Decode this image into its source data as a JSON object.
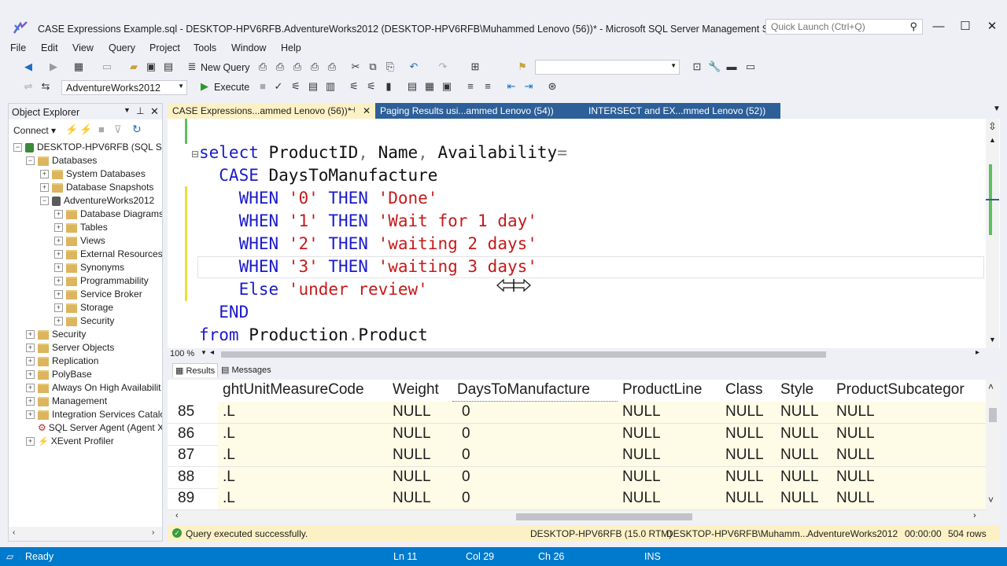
{
  "window": {
    "title": "CASE Expressions Example.sql - DESKTOP-HPV6RFB.AdventureWorks2012 (DESKTOP-HPV6RFB\\Muhammed Lenovo (56))* - Microsoft SQL Server Management Studio (Adm...",
    "quick_launch_placeholder": "Quick Launch (Ctrl+Q)",
    "minimize": "—",
    "maximize": "☐",
    "close": "✕"
  },
  "menu": [
    "File",
    "Edit",
    "View",
    "Query",
    "Project",
    "Tools",
    "Window",
    "Help"
  ],
  "toolbar": {
    "new_query": "New Query",
    "database": "AdventureWorks2012",
    "execute": "Execute"
  },
  "object_explorer": {
    "title": "Object Explorer",
    "connect": "Connect",
    "tree": [
      {
        "label": "DESKTOP-HPV6RFB (SQL Serv",
        "level": 0,
        "icon": "server",
        "exp": "−"
      },
      {
        "label": "Databases",
        "level": 1,
        "icon": "folder",
        "exp": "−"
      },
      {
        "label": "System Databases",
        "level": 2,
        "icon": "folder",
        "exp": "+"
      },
      {
        "label": "Database Snapshots",
        "level": 2,
        "icon": "folder",
        "exp": "+"
      },
      {
        "label": "AdventureWorks2012",
        "level": 2,
        "icon": "db",
        "exp": "−"
      },
      {
        "label": "Database Diagrams",
        "level": 3,
        "icon": "folder",
        "exp": "+"
      },
      {
        "label": "Tables",
        "level": 3,
        "icon": "folder",
        "exp": "+"
      },
      {
        "label": "Views",
        "level": 3,
        "icon": "folder",
        "exp": "+"
      },
      {
        "label": "External Resources",
        "level": 3,
        "icon": "folder",
        "exp": "+"
      },
      {
        "label": "Synonyms",
        "level": 3,
        "icon": "folder",
        "exp": "+"
      },
      {
        "label": "Programmability",
        "level": 3,
        "icon": "folder",
        "exp": "+"
      },
      {
        "label": "Service Broker",
        "level": 3,
        "icon": "folder",
        "exp": "+"
      },
      {
        "label": "Storage",
        "level": 3,
        "icon": "folder",
        "exp": "+"
      },
      {
        "label": "Security",
        "level": 3,
        "icon": "folder",
        "exp": "+"
      },
      {
        "label": "Security",
        "level": 1,
        "icon": "folder",
        "exp": "+"
      },
      {
        "label": "Server Objects",
        "level": 1,
        "icon": "folder",
        "exp": "+"
      },
      {
        "label": "Replication",
        "level": 1,
        "icon": "folder",
        "exp": "+"
      },
      {
        "label": "PolyBase",
        "level": 1,
        "icon": "folder",
        "exp": "+"
      },
      {
        "label": "Always On High Availabilit",
        "level": 1,
        "icon": "folder",
        "exp": "+"
      },
      {
        "label": "Management",
        "level": 1,
        "icon": "folder",
        "exp": "+"
      },
      {
        "label": "Integration Services Catalo",
        "level": 1,
        "icon": "folder",
        "exp": "+"
      },
      {
        "label": "SQL Server Agent (Agent X",
        "level": 1,
        "icon": "agent",
        "exp": ""
      },
      {
        "label": "XEvent Profiler",
        "level": 1,
        "icon": "xevent",
        "exp": "+"
      }
    ]
  },
  "tabs": [
    {
      "label": "CASE Expressions...ammed Lenovo (56))*",
      "active": true
    },
    {
      "label": "Paging Results usi...ammed Lenovo (54))",
      "active": false
    },
    {
      "label": "INTERSECT and EX...mmed Lenovo (52))",
      "active": false
    }
  ],
  "editor": {
    "lines": [
      [
        {
          "t": "select",
          "c": "kw"
        },
        {
          "t": " ProductID",
          "c": "id"
        },
        {
          "t": ",",
          "c": "gry"
        },
        {
          "t": " Name",
          "c": "id"
        },
        {
          "t": ",",
          "c": "gry"
        },
        {
          "t": " Availability",
          "c": "id"
        },
        {
          "t": "=",
          "c": "gry"
        }
      ],
      [
        {
          "t": "  CASE",
          "c": "kw"
        },
        {
          "t": " DaysToManufacture",
          "c": "id"
        }
      ],
      [
        {
          "t": "    WHEN",
          "c": "kw"
        },
        {
          "t": " '0'",
          "c": "str"
        },
        {
          "t": " THEN",
          "c": "kw"
        },
        {
          "t": " 'Done'",
          "c": "str"
        }
      ],
      [
        {
          "t": "    WHEN",
          "c": "kw"
        },
        {
          "t": " '1'",
          "c": "str"
        },
        {
          "t": " THEN",
          "c": "kw"
        },
        {
          "t": " 'Wait for 1 day'",
          "c": "str"
        }
      ],
      [
        {
          "t": "    WHEN",
          "c": "kw"
        },
        {
          "t": " '2'",
          "c": "str"
        },
        {
          "t": " THEN",
          "c": "kw"
        },
        {
          "t": " 'waiting 2 days'",
          "c": "str"
        }
      ],
      [
        {
          "t": "    WHEN",
          "c": "kw"
        },
        {
          "t": " '3'",
          "c": "str"
        },
        {
          "t": " THEN",
          "c": "kw"
        },
        {
          "t": " 'waiting 3 days'",
          "c": "str"
        }
      ],
      [
        {
          "t": "    Else",
          "c": "kw"
        },
        {
          "t": " 'under review'",
          "c": "str"
        }
      ],
      [
        {
          "t": "  END",
          "c": "kw"
        }
      ],
      [
        {
          "t": "from",
          "c": "kw"
        },
        {
          "t": " Production",
          "c": "id"
        },
        {
          "t": ".",
          "c": "gry"
        },
        {
          "t": "Product",
          "c": "id"
        }
      ]
    ]
  },
  "zoom": "100 %",
  "results": {
    "tab_results": "Results",
    "tab_messages": "Messages",
    "columns": [
      "ghtUnitMeasureCode",
      "Weight",
      "DaysToManufacture",
      "ProductLine",
      "Class",
      "Style",
      "ProductSubcategor"
    ],
    "rows": [
      {
        "n": "85",
        "cells": [
          ".L",
          "NULL",
          "0",
          "NULL",
          "NULL",
          "NULL",
          "NULL"
        ]
      },
      {
        "n": "86",
        "cells": [
          ".L",
          "NULL",
          "0",
          "NULL",
          "NULL",
          "NULL",
          "NULL"
        ]
      },
      {
        "n": "87",
        "cells": [
          ".L",
          "NULL",
          "0",
          "NULL",
          "NULL",
          "NULL",
          "NULL"
        ]
      },
      {
        "n": "88",
        "cells": [
          ".L",
          "NULL",
          "0",
          "NULL",
          "NULL",
          "NULL",
          "NULL"
        ]
      },
      {
        "n": "89",
        "cells": [
          ".L",
          "NULL",
          "0",
          "NULL",
          "NULL",
          "NULL",
          "NULL"
        ]
      }
    ]
  },
  "query_status": {
    "message": "Query executed successfully.",
    "server": "DESKTOP-HPV6RFB (15.0 RTM)",
    "user": "DESKTOP-HPV6RFB\\Muhamm...",
    "database": "AdventureWorks2012",
    "time": "00:00:00",
    "rows": "504 rows"
  },
  "statusbar": {
    "ready": "Ready",
    "ln": "Ln 11",
    "col": "Col 29",
    "ch": "Ch 26",
    "ins": "INS"
  },
  "colors": {
    "accent": "#007acc",
    "keyword": "#1a1acb",
    "string": "#c51a1a",
    "active_tab": "#fcf1c5"
  }
}
